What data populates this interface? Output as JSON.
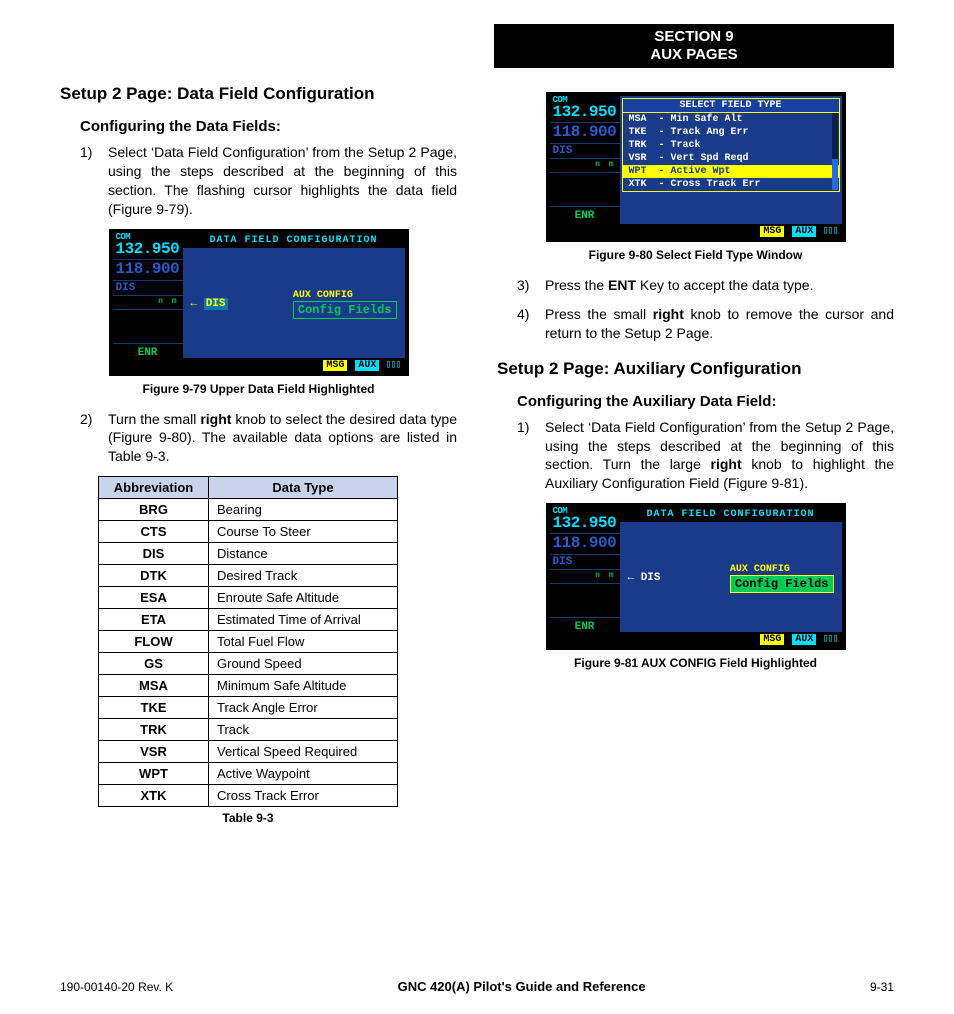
{
  "banner": {
    "line1": "SECTION 9",
    "line2": "AUX PAGES"
  },
  "left": {
    "heading": "Setup 2 Page: Data Field Configuration",
    "sub1": "Configuring the Data Fields:",
    "step1_num": "1)",
    "step1": "Select ‘Data Field Configuration’ from the Setup 2 Page, using the steps described at the beginning of this section.  The flashing cursor highlights the  data field (Figure 9-79).",
    "fig79_caption": "Figure 9-79  Upper Data Field Highlighted",
    "step2_num": "2)",
    "step2_a": "Turn the small ",
    "step2_b": "right",
    "step2_c": " knob to select the desired data type (Figure 9-80).  The available data options are listed in Table 9-3.",
    "table": {
      "h1": "Abbreviation",
      "h2": "Data Type",
      "rows": [
        {
          "a": "BRG",
          "d": "Bearing"
        },
        {
          "a": "CTS",
          "d": "Course To Steer"
        },
        {
          "a": "DIS",
          "d": "Distance"
        },
        {
          "a": "DTK",
          "d": "Desired Track"
        },
        {
          "a": "ESA",
          "d": "Enroute Safe Altitude"
        },
        {
          "a": "ETA",
          "d": "Estimated Time of Arrival"
        },
        {
          "a": "FLOW",
          "d": "Total Fuel Flow"
        },
        {
          "a": "GS",
          "d": "Ground Speed"
        },
        {
          "a": "MSA",
          "d": "Minimum Safe Altitude"
        },
        {
          "a": "TKE",
          "d": "Track Angle Error"
        },
        {
          "a": "TRK",
          "d": "Track"
        },
        {
          "a": "VSR",
          "d": "Vertical Speed Required"
        },
        {
          "a": "WPT",
          "d": "Active Waypoint"
        },
        {
          "a": "XTK",
          "d": "Cross Track Error"
        }
      ],
      "caption": "Table 9-3"
    }
  },
  "right": {
    "fig80_caption": "Figure 9-80  Select Field Type Window",
    "step3_num": "3)",
    "step3_a": "Press the ",
    "step3_b": "ENT",
    "step3_c": " Key to accept the data type.",
    "step4_num": "4)",
    "step4_a": "Press the small ",
    "step4_b": "right",
    "step4_c": " knob to remove the cursor and return to the Setup 2 Page.",
    "heading2": "Setup 2 Page: Auxiliary Configuration",
    "sub2": "Configuring the Auxiliary Data Field:",
    "step1b_num": "1)",
    "step1b_a": "Select ‘Data Field Configuration’ from the Setup 2 Page, using the steps described at the beginning of this section.  Turn the large ",
    "step1b_b": "right",
    "step1b_c": " knob to highlight the Auxiliary Configuration Field (Figure 9-81).",
    "fig81_caption": "Figure 9-81  AUX CONFIG Field Highlighted"
  },
  "gps": {
    "com_label": "COM",
    "freq_active": "132.950",
    "freq_standby": "118.900",
    "dis": "DIS",
    "enr": "ENR",
    "title_dfc": "DATA FIELD CONFIGURATION",
    "arrow_dis": "← DIS",
    "aux_label": "AUX CONFIG",
    "aux_value": "Config Fields",
    "msg": "MSG",
    "aux": "AUX",
    "bars": "▯▯▯",
    "popup": {
      "title": "SELECT FIELD TYPE",
      "rows": [
        "MSA  - Min Safe Alt",
        "TKE  - Track Ang Err",
        "TRK  - Track",
        "VSR  - Vert Spd Reqd",
        "WPT  - Active Wpt",
        "XTK  - Cross Track Err"
      ],
      "sel_index": 4
    }
  },
  "footer": {
    "left": "190-00140-20  Rev. K",
    "center": "GNC 420(A) Pilot's Guide and Reference",
    "right": "9-31"
  }
}
